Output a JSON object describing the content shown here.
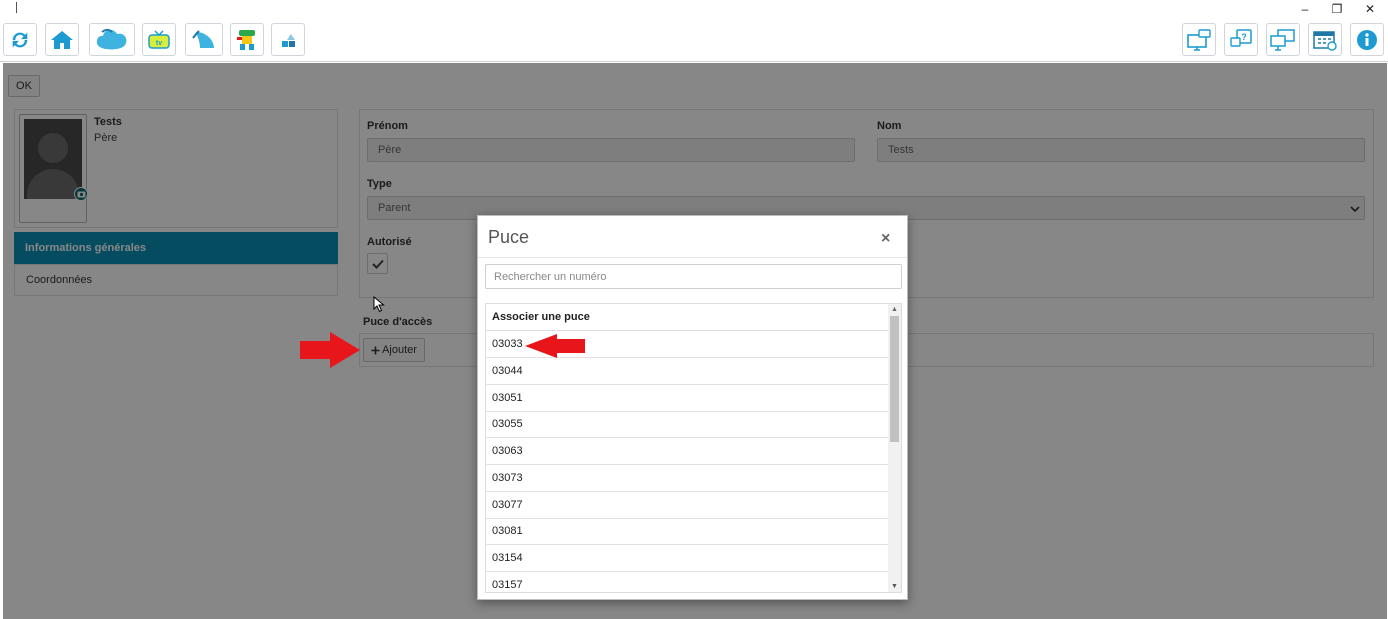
{
  "window": {
    "minimize": "–",
    "restore": "❐",
    "close": "✕"
  },
  "toolbar": {
    "left_icons": [
      "refresh-icon",
      "home-icon",
      "cloud-icon",
      "tv-icon",
      "wave-icon",
      "character-icon",
      "shapes-icon"
    ],
    "right_icons": [
      "monitor-message-icon",
      "help-chat-icon",
      "multi-monitor-icon",
      "calendar-icon",
      "info-icon"
    ],
    "accent": "#1d9bd1"
  },
  "page": {
    "ok_label": "OK"
  },
  "profile": {
    "name": "Tests",
    "role": "Père"
  },
  "nav": {
    "items": [
      {
        "label": "Informations générales",
        "active": true
      },
      {
        "label": "Coordonnées",
        "active": false
      }
    ],
    "active_color": "#0b90b8"
  },
  "form": {
    "prenom_label": "Prénom",
    "prenom_value": "Père",
    "nom_label": "Nom",
    "nom_value": "Tests",
    "type_label": "Type",
    "type_value": "Parent",
    "autorise_label": "Autorisé",
    "autorise_checked": true
  },
  "access": {
    "label": "Puce d'accès",
    "add_label": "Ajouter"
  },
  "modal": {
    "title": "Puce",
    "close": "×",
    "search_placeholder": "Rechercher un numéro",
    "list_header": "Associer une puce",
    "items": [
      "03033",
      "03044",
      "03051",
      "03055",
      "03063",
      "03073",
      "03077",
      "03081",
      "03154",
      "03157"
    ],
    "scroll_up": "▲",
    "scroll_down": "▼"
  },
  "annotation_color": "#e8151b"
}
